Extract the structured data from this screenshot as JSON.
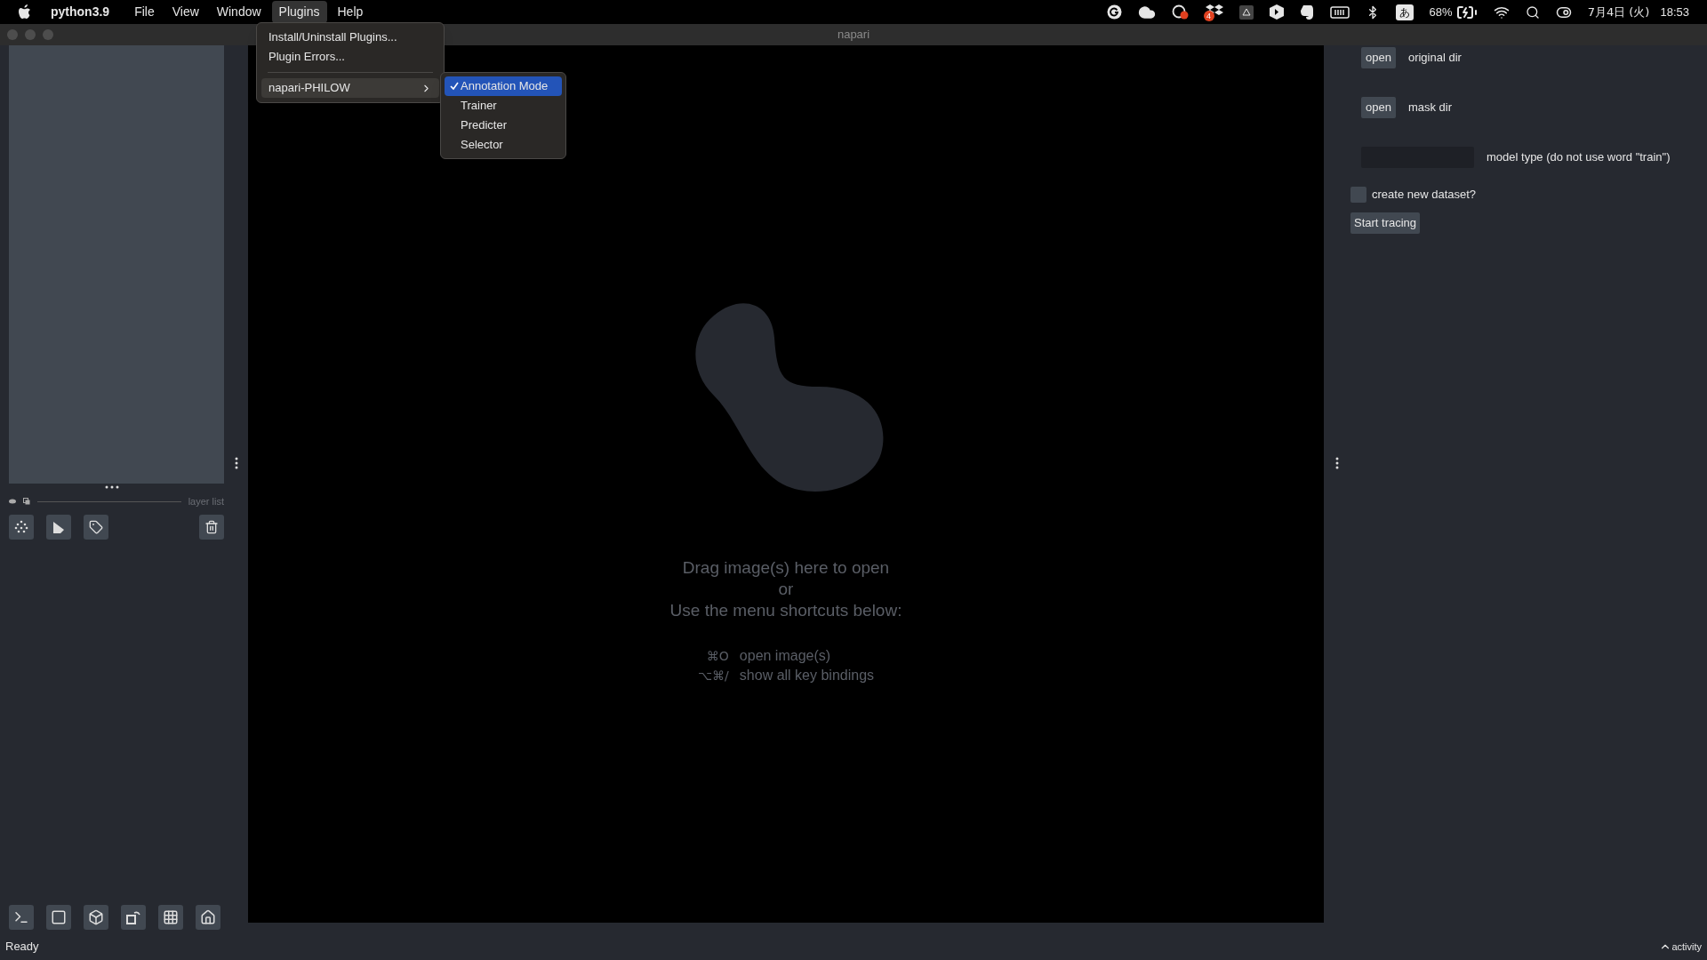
{
  "menu_bar": {
    "app": "python3.9",
    "menus": [
      {
        "label": "File",
        "selected": false
      },
      {
        "label": "View",
        "selected": false
      },
      {
        "label": "Window",
        "selected": false
      },
      {
        "label": "Plugins",
        "selected": true
      },
      {
        "label": "Help",
        "selected": false
      }
    ],
    "status": {
      "badge": "4",
      "input_method": "あ",
      "battery": "68%",
      "date": "7月4日 (火)",
      "time": "18:53"
    }
  },
  "window": {
    "title": "napari"
  },
  "plugins_menu": {
    "items": [
      {
        "label": "Install/Uninstall Plugins...",
        "submenu": false,
        "selected": false
      },
      {
        "label": "Plugin Errors...",
        "submenu": false,
        "selected": false
      },
      {
        "label": "napari-PHILOW",
        "submenu": true,
        "selected": true
      }
    ]
  },
  "submenu": {
    "items": [
      {
        "label": "Annotation Mode",
        "checked": true,
        "selected": true
      },
      {
        "label": "Trainer",
        "checked": false,
        "selected": false
      },
      {
        "label": "Predicter",
        "checked": false,
        "selected": false
      },
      {
        "label": "Selector",
        "checked": false,
        "selected": false
      }
    ]
  },
  "layer_panel": {
    "label": "layer list"
  },
  "canvas": {
    "welcome_lines": [
      "Drag image(s) here to open",
      "or",
      "Use the menu shortcuts below:"
    ],
    "shortcuts": [
      {
        "keys": "⌘O",
        "action": "open image(s)"
      },
      {
        "keys": "⌥⌘/",
        "action": "show all key bindings"
      }
    ]
  },
  "widget": {
    "rows": [
      {
        "kind": "dir",
        "button": "open",
        "label": "original dir"
      },
      {
        "kind": "dir",
        "button": "open",
        "label": "mask dir"
      },
      {
        "kind": "text",
        "label": "model type (do not use word \"train\")"
      },
      {
        "kind": "checkbox",
        "label": "create new dataset?",
        "checked": false
      },
      {
        "kind": "button",
        "label": "Start tracing"
      }
    ]
  },
  "status_bar": {
    "message": "Ready",
    "activity": "activity"
  }
}
